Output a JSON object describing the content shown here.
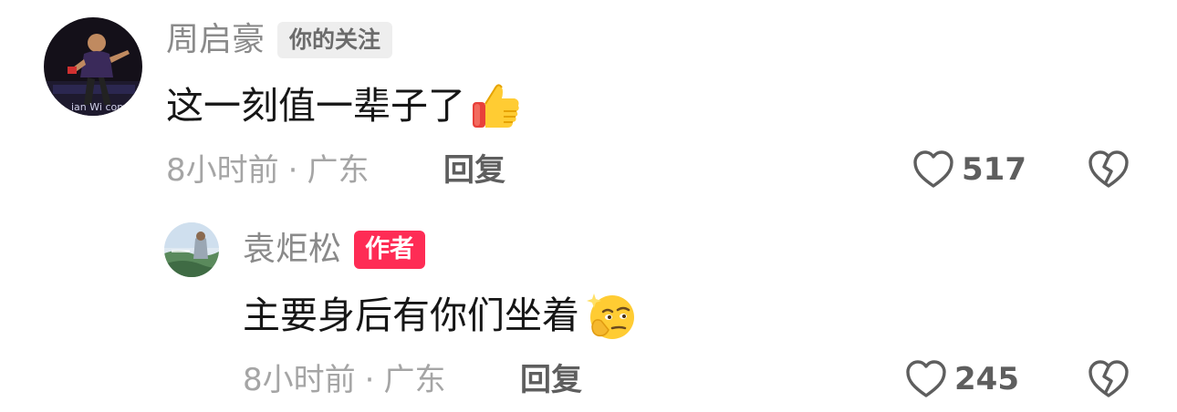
{
  "comments": [
    {
      "user": "周启豪",
      "badge": "你的关注",
      "text": "这一刻值一辈子了",
      "emoji": "thumbs-up-icon",
      "time": "8小时前",
      "separator": "·",
      "location": "广东",
      "reply_label": "回复",
      "likes": "517"
    },
    {
      "user": "袁炬松",
      "badge": "作者",
      "text": "主要身后有你们坐着",
      "emoji": "thinking-face-icon",
      "time": "8小时前",
      "separator": "·",
      "location": "广东",
      "reply_label": "回复",
      "likes": "245"
    }
  ],
  "colors": {
    "author_badge": "#fe2c55",
    "follow_badge_bg": "#eeeeee",
    "name": "#8a8a8a",
    "meta": "#a5a5a5"
  },
  "icons": [
    "heart-outline-icon",
    "dislike-broken-heart-icon",
    "thumbs-up-icon",
    "thinking-face-icon"
  ]
}
